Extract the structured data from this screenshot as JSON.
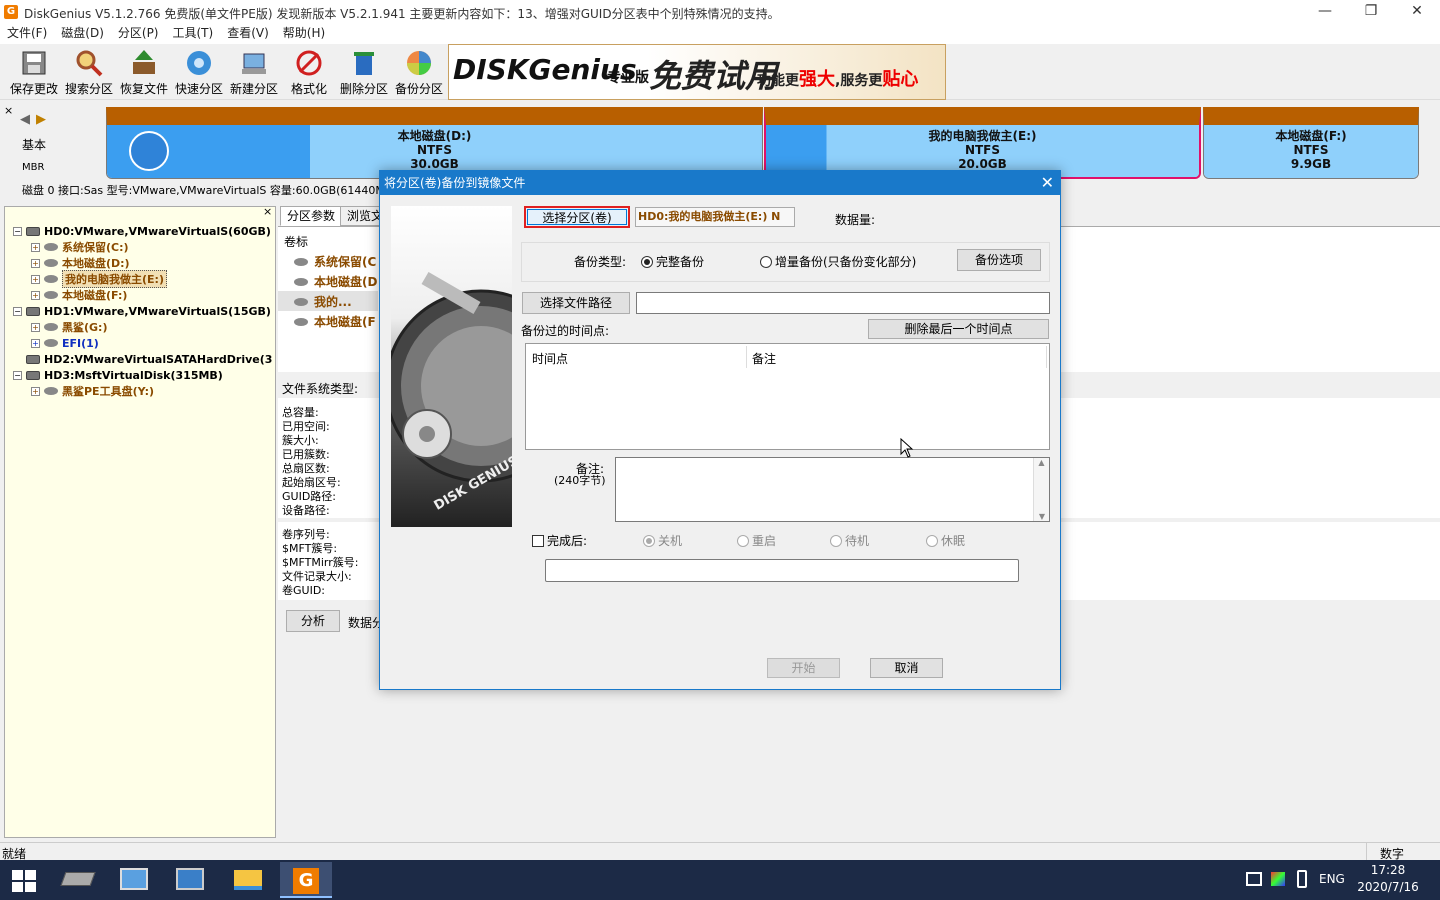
{
  "window": {
    "title": "DiskGenius V5.1.2.766 免费版(单文件PE版)    发现新版本 V5.2.1.941 主要更新内容如下：13、增强对GUID分区表中个别特殊情况的支持。",
    "app_icon": "G"
  },
  "menu": [
    "文件(F)",
    "磁盘(D)",
    "分区(P)",
    "工具(T)",
    "查看(V)",
    "帮助(H)"
  ],
  "toolbar": [
    {
      "label": "保存更改",
      "icon": "save-icon"
    },
    {
      "label": "搜索分区",
      "icon": "search-icon"
    },
    {
      "label": "恢复文件",
      "icon": "recover-icon"
    },
    {
      "label": "快速分区",
      "icon": "quick-partition-icon"
    },
    {
      "label": "新建分区",
      "icon": "new-partition-icon"
    },
    {
      "label": "格式化",
      "icon": "format-icon"
    },
    {
      "label": "删除分区",
      "icon": "delete-icon"
    },
    {
      "label": "备份分区",
      "icon": "backup-icon"
    }
  ],
  "banner": {
    "logo": "DISKGenius",
    "edition": "专业版",
    "trial": "免费试用",
    "slogan_a": "功能更",
    "slogan_b": "强大",
    "slogan_c": ",服务更",
    "slogan_d": "贴心"
  },
  "diskmap": {
    "type_label": "基本",
    "scheme_label": "MBR",
    "info": "磁盘 0 接口:Sas  型号:VMware,VMwareVirtualS  容量:60.0GB(61440MB)",
    "partitions": [
      {
        "name": "本地磁盘(D:)",
        "fs": "NTFS",
        "size": "30.0GB"
      },
      {
        "name": "我的电脑我做主(E:)",
        "fs": "NTFS",
        "size": "20.0GB"
      },
      {
        "name": "本地磁盘(F:)",
        "fs": "NTFS",
        "size": "9.9GB"
      }
    ]
  },
  "tree": [
    {
      "label": "HD0:VMware,VMwareVirtualS(60GB)",
      "level": 0,
      "kind": "disk"
    },
    {
      "label": "系统保留(C:)",
      "level": 1,
      "kind": "part"
    },
    {
      "label": "本地磁盘(D:)",
      "level": 1,
      "kind": "part"
    },
    {
      "label": "我的电脑我做主(E:)",
      "level": 1,
      "kind": "part",
      "selected": true
    },
    {
      "label": "本地磁盘(F:)",
      "level": 1,
      "kind": "part"
    },
    {
      "label": "HD1:VMware,VMwareVirtualS(15GB)",
      "level": 0,
      "kind": "disk"
    },
    {
      "label": "黑鲨(G:)",
      "level": 1,
      "kind": "part"
    },
    {
      "label": "EFI(1)",
      "level": 1,
      "kind": "part",
      "blue": true
    },
    {
      "label": "HD2:VMwareVirtualSATAHardDrive(3",
      "level": 0,
      "kind": "disk"
    },
    {
      "label": "HD3:MsftVirtualDisk(315MB)",
      "level": 0,
      "kind": "disk"
    },
    {
      "label": "黑鲨PE工具盘(Y:)",
      "level": 1,
      "kind": "part"
    }
  ],
  "mid": {
    "tabs": [
      "分区参数",
      "浏览文"
    ],
    "volume_header": "卷标",
    "volumes": [
      "系统保留(C",
      "本地磁盘(D",
      "我的...",
      "本地磁盘(F"
    ],
    "fs_type_label": "文件系统类型:",
    "labels_a": [
      "总容量:",
      "已用空间:",
      "簇大小:",
      "已用簇数:",
      "总扇区数:",
      "起始扇区号:",
      "GUID路径:",
      "设备路径:"
    ],
    "labels_b": [
      "卷序列号:",
      "$MFT簇号:",
      "$MFTMirr簇号:",
      "文件记录大小:",
      "卷GUID:"
    ],
    "analyze_btn": "分析",
    "data_dist": "数据分"
  },
  "status": {
    "left": "就绪",
    "right": "数字"
  },
  "taskbar": {
    "lang": "ENG",
    "time": "17:28",
    "date": "2020/7/16"
  },
  "dialog": {
    "title": "将分区(卷)备份到镜像文件",
    "select_partition_btn": "选择分区(卷)",
    "selected_partition": "HD0:我的电脑我做主(E:) N",
    "data_size_label": "数据量:",
    "backup_type_label": "备份类型:",
    "full_backup": "完整备份",
    "incremental_backup": "增量备份(只备份变化部分)",
    "backup_options_btn": "备份选项",
    "select_path_btn": "选择文件路径",
    "path_value": "",
    "timepoints_label": "备份过的时间点:",
    "delete_last_btn": "删除最后一个时间点",
    "col_time": "时间点",
    "col_note": "备注",
    "note_label": "备注:",
    "note_limit": "(240字节)",
    "after_done_label": "完成后:",
    "opt_shutdown": "关机",
    "opt_restart": "重启",
    "opt_standby": "待机",
    "opt_hibernate": "休眠",
    "start_btn": "开始",
    "cancel_btn": "取消",
    "image_text": "DISK GENIUS"
  }
}
